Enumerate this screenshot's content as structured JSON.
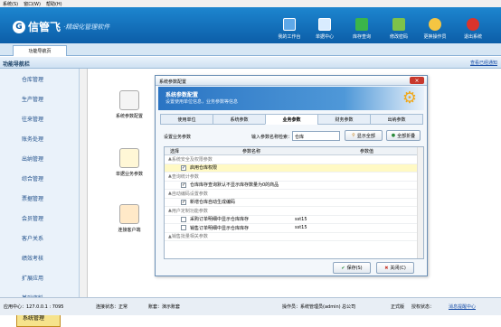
{
  "menubar": [
    "系统(S)",
    "窗口(W)",
    "帮助(H)"
  ],
  "app": {
    "brand": "信管飞",
    "slogan": "·精细化管理软件"
  },
  "toolbar": [
    {
      "label": "我的工作台",
      "icon": "monitor-icon",
      "color": "#5fa8e8"
    },
    {
      "label": "单据中心",
      "icon": "document-icon",
      "color": "#d9ecff"
    },
    {
      "label": "库存查询",
      "icon": "calendar-icon",
      "color": "#3bb54a"
    },
    {
      "label": "修改密码",
      "icon": "pencil-icon",
      "color": "#7ec24a"
    },
    {
      "label": "更换操作员",
      "icon": "user-icon",
      "color": "#f4c542"
    },
    {
      "label": "退出系统",
      "icon": "close-icon",
      "color": "#d9342b"
    }
  ],
  "tab": "功能导航页",
  "nav": {
    "title": "功能导航栏",
    "link": "查看已经通知"
  },
  "sidebar": [
    "仓库管理",
    "生产管理",
    "往来管理",
    "账务处理",
    "出纳管理",
    "综合管理",
    "票据管理",
    "会员管理",
    "客户关系",
    "绩效考核",
    "扩展应用",
    "基础资料",
    "系统管理"
  ],
  "main_icons": [
    {
      "label": "系统参数配置"
    },
    {
      "label": "单据业务参数"
    },
    {
      "label": "连接客户端"
    }
  ],
  "dialog": {
    "title": "系统参数配置",
    "banner_title": "系统参数配置",
    "banner_sub": "设置使用单位信息，业务参数等信息",
    "tabs": [
      "使用单位",
      "系统参数",
      "业务参数",
      "财务参数",
      "出纳参数"
    ],
    "active_tab": 2,
    "search_label": "设置业务参数",
    "search_hint": "输入参数名称检索：",
    "search_value": "仓库",
    "btn_show_all": "显示全部",
    "btn_collapse": "全部折叠",
    "columns": [
      "选择",
      "参数名称",
      "参数值"
    ],
    "rows": [
      {
        "type": "group",
        "name": "系统安全及权限参数",
        "value": ""
      },
      {
        "type": "item",
        "checked": true,
        "name": "启用仓库权限",
        "value": "",
        "highlight": true
      },
      {
        "type": "group",
        "name": "查询统计参数",
        "value": ""
      },
      {
        "type": "item",
        "checked": true,
        "name": "仓库库存查询默认不显示库存数量为0的商品",
        "value": ""
      },
      {
        "type": "group",
        "name": "自动编码设置参数",
        "value": ""
      },
      {
        "type": "item",
        "checked": true,
        "name": "新增仓库自动生成编码",
        "value": ""
      },
      {
        "type": "group",
        "name": "用户定制功能参数",
        "value": ""
      },
      {
        "type": "item",
        "checked": false,
        "name": "采购订单明细中显示仓库库存",
        "value": "sst15"
      },
      {
        "type": "item",
        "checked": false,
        "name": "销售订单明细中显示仓库库存",
        "value": "sst15"
      },
      {
        "type": "group",
        "name": "销售批量相关参数",
        "value": ""
      }
    ],
    "save": "保存(S)",
    "close": "关闭(C)"
  },
  "status": {
    "server": "应用中心：127.0.0.1 : 7095",
    "conn": "连接状态：正常",
    "account": "账套：演示账套",
    "operator": "操作员：系统管理员(admin)  总公司",
    "version": "正式版",
    "auth": "授权状态：",
    "msg": "消息提醒中心"
  }
}
